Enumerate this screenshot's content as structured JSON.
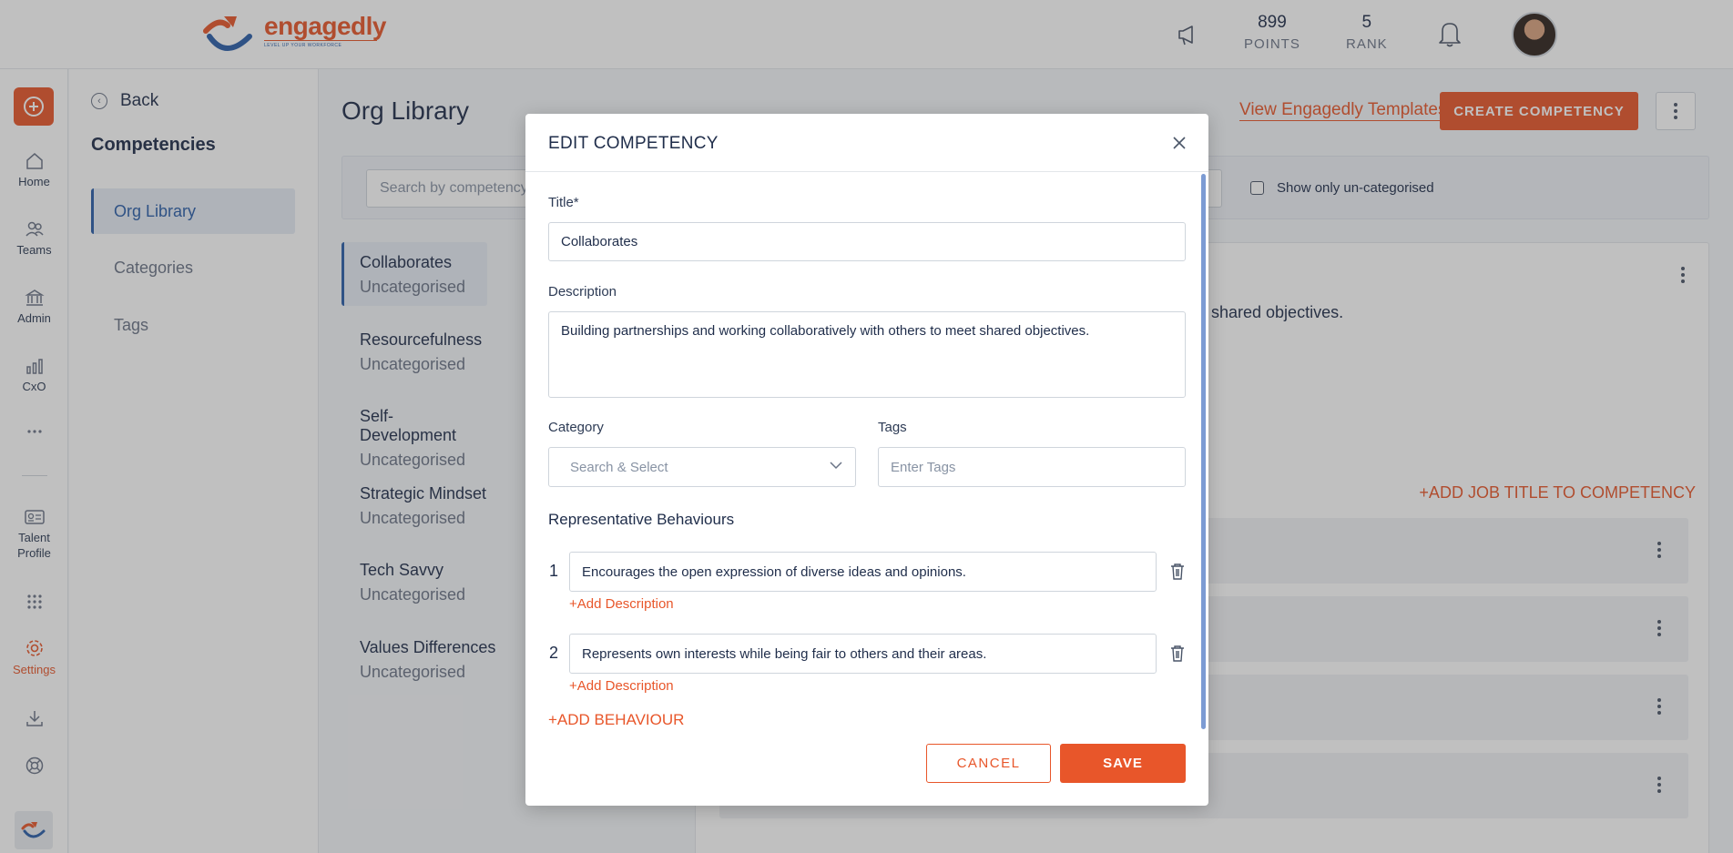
{
  "header": {
    "logo_name": "engagedly",
    "logo_tagline": "LEVEL UP YOUR WORKFORCE",
    "points_value": "899",
    "points_label": "POINTS",
    "rank_value": "5",
    "rank_label": "RANK"
  },
  "rail": {
    "items": [
      {
        "label": "Home",
        "icon": "home-icon"
      },
      {
        "label": "Teams",
        "icon": "teams-icon"
      },
      {
        "label": "Admin",
        "icon": "admin-icon"
      },
      {
        "label": "CxO",
        "icon": "chart-icon"
      },
      {
        "label": "Talent Profile",
        "icon": "id-card-icon"
      },
      {
        "label": "Settings",
        "icon": "gear-icon"
      }
    ],
    "accent": "#e8562a"
  },
  "subside": {
    "back_label": "Back",
    "title": "Competencies",
    "items": [
      {
        "label": "Org Library",
        "active": true
      },
      {
        "label": "Categories",
        "active": false
      },
      {
        "label": "Tags",
        "active": false
      }
    ]
  },
  "main": {
    "title": "Org Library",
    "view_templates": "View Engagedly Templates",
    "create_button": "CREATE COMPETENCY",
    "search_placeholder": "Search by competency,",
    "uncategorised_filter": "Show only un-categorised",
    "competencies": [
      {
        "name": "Collaborates",
        "category": "Uncategorised",
        "active": true
      },
      {
        "name": "Resourcefulness",
        "category": "Uncategorised",
        "active": false
      },
      {
        "name": "Self-Development",
        "category": "Uncategorised",
        "active": false
      },
      {
        "name": "Strategic Mindset",
        "category": "Uncategorised",
        "active": false
      },
      {
        "name": "Tech Savvy",
        "category": "Uncategorised",
        "active": false
      },
      {
        "name": "Values Differences",
        "category": "Uncategorised",
        "active": false
      }
    ],
    "detail_desc_visible": "shared objectives.",
    "add_job_title": "+ADD JOB TITLE TO COMPETENCY"
  },
  "modal": {
    "title": "EDIT COMPETENCY",
    "title_label": "Title*",
    "title_value": "Collaborates",
    "description_label": "Description",
    "description_value": "Building partnerships and working collaboratively with others to meet shared objectives.",
    "category_label": "Category",
    "category_placeholder": "Search & Select",
    "tags_label": "Tags",
    "tags_placeholder": "Enter Tags",
    "behaviours_title": "Representative Behaviours",
    "behaviours": [
      {
        "num": "1",
        "text": "Encourages the open expression of diverse ideas and opinions.",
        "add_desc": "+Add Description"
      },
      {
        "num": "2",
        "text": "Represents own interests while being fair to others and their areas.",
        "add_desc": "+Add Description"
      }
    ],
    "add_behaviour": "+ADD BEHAVIOUR",
    "cancel": "CANCEL",
    "save": "SAVE"
  }
}
